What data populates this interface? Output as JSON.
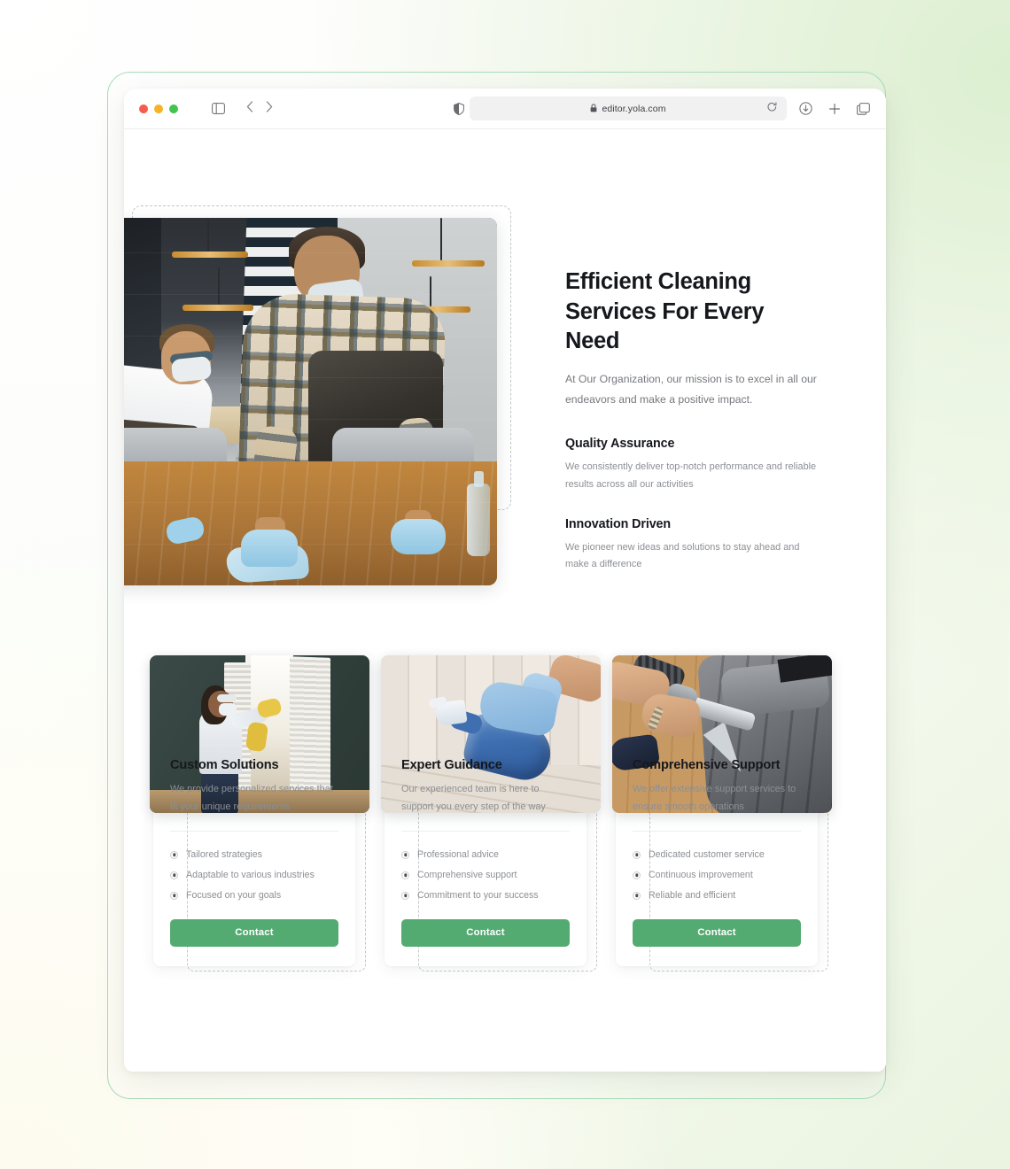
{
  "browser": {
    "url": "editor.yola.com",
    "lock_icon": "lock-icon",
    "traffic_lights": [
      "close-red",
      "minimize-yellow",
      "maximize-green"
    ],
    "icons": {
      "sidebar": "sidebar-toggle-icon",
      "back": "chevron-left-icon",
      "forward": "chevron-right-icon",
      "shield": "privacy-shield-icon",
      "reload": "reload-icon",
      "download": "download-icon",
      "new_tab": "plus-icon",
      "tabs": "tab-overview-icon"
    }
  },
  "hero": {
    "heading": "Efficient Cleaning Services For Every Need",
    "subheading": "At Our Organization, our mission is to excel in all our endeavors and make a positive impact.",
    "image_alt": "worker-cleaning-table",
    "features": [
      {
        "title": "Quality Assurance",
        "text": "We consistently deliver top-notch performance and reliable results across all our activities"
      },
      {
        "title": "Innovation Driven",
        "text": "We pioneer new ideas and solutions to stay ahead and make a difference"
      }
    ]
  },
  "cards": [
    {
      "image_alt": "woman-cleaning-window",
      "title": "Custom Solutions",
      "description": "We provide personalized services that fit your unique requirements",
      "bullets": [
        "Tailored strategies",
        "Adaptable to various industries",
        "Focused on your goals"
      ],
      "button_label": "Contact"
    },
    {
      "image_alt": "gloved-hand-with-spray-bottle",
      "title": "Expert Guidance",
      "description": "Our experienced team is here to support you every step of the way",
      "bullets": [
        "Professional advice",
        "Comprehensive support",
        "Commitment to your success"
      ],
      "button_label": "Contact"
    },
    {
      "image_alt": "upholstery-cleaning-sofa",
      "title": "Comprehensive Support",
      "description": "We offer extensive support services to ensure smooth operations",
      "bullets": [
        "Dedicated customer service",
        "Continuous improvement",
        "Reliable and efficient"
      ],
      "button_label": "Contact"
    }
  ],
  "colors": {
    "accent_green": "#54ab72",
    "heading": "#16181d",
    "body_text": "#8c8f94",
    "frame_outline": "#a9dcbb",
    "dashed_selection": "#c3c6c8"
  }
}
